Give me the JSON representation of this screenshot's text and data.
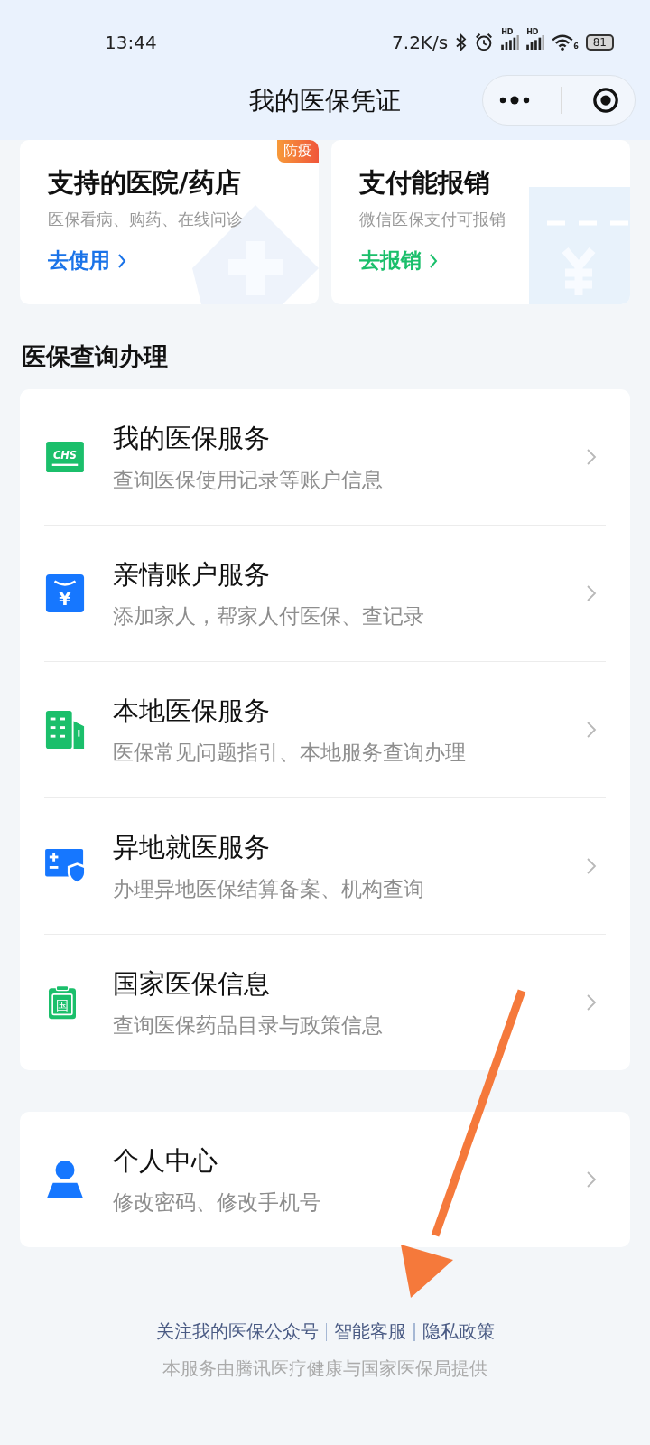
{
  "status_bar": {
    "time": "13:44",
    "speed": "7.2K/s",
    "signal_labels": [
      "HD",
      "HD"
    ],
    "wifi_label": "6",
    "battery": "81"
  },
  "nav": {
    "title": "我的医保凭证"
  },
  "cards": [
    {
      "kind": "hospital",
      "badge": "防疫",
      "title": "支持的医院/药店",
      "subtitle": "医保看病、购药、在线问诊",
      "link": "去使用"
    },
    {
      "kind": "reimburse",
      "title": "支付能报销",
      "subtitle": "微信医保支付可报销",
      "link": "去报销"
    }
  ],
  "section_title": "医保查询办理",
  "services": [
    {
      "kind": "chs",
      "icon_text": "CHS",
      "title": "我的医保服务",
      "subtitle": "查询医保使用记录等账户信息"
    },
    {
      "kind": "yuan",
      "icon_text": "¥",
      "title": "亲情账户服务",
      "subtitle": "添加家人，帮家人付医保、查记录"
    },
    {
      "kind": "building",
      "title": "本地医保服务",
      "subtitle": "医保常见问题指引、本地服务查询办理"
    },
    {
      "kind": "remote",
      "title": "异地就医服务",
      "subtitle": "办理异地医保结算备案、机构查询"
    },
    {
      "kind": "nation",
      "icon_text": "国",
      "title": "国家医保信息",
      "subtitle": "查询医保药品目录与政策信息"
    }
  ],
  "personal": [
    {
      "kind": "person",
      "title": "个人中心",
      "subtitle": "修改密码、修改手机号"
    }
  ],
  "footer": {
    "links": [
      "关注我的医保公众号",
      "智能客服",
      "隐私政策"
    ],
    "note": "本服务由腾讯医疗健康与国家医保局提供"
  }
}
